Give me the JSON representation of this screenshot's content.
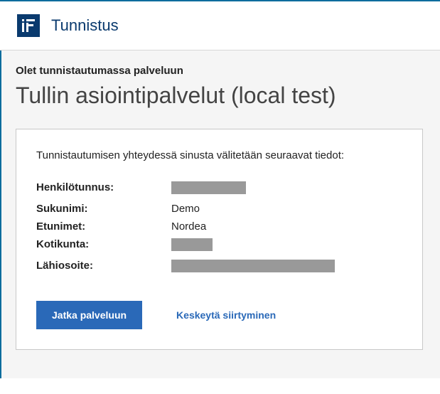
{
  "header": {
    "brand": "Tunnistus"
  },
  "main": {
    "intro": "Olet tunnistautumassa palveluun",
    "title": "Tullin asiointipalvelut (local test)"
  },
  "card": {
    "description": "Tunnistautumisen yhteydessä sinusta välitetään seuraavat tiedot:",
    "rows": {
      "henkilotunnus_label": "Henkilötunnus:",
      "sukunimi_label": "Sukunimi:",
      "sukunimi_value": "Demo",
      "etunimet_label": "Etunimet:",
      "etunimet_value": "Nordea",
      "kotikunta_label": "Kotikunta:",
      "lahiosoite_label": "Lähiosoite:"
    },
    "buttons": {
      "continue": "Jatka palveluun",
      "cancel": "Keskeytä siirtyminen"
    }
  }
}
